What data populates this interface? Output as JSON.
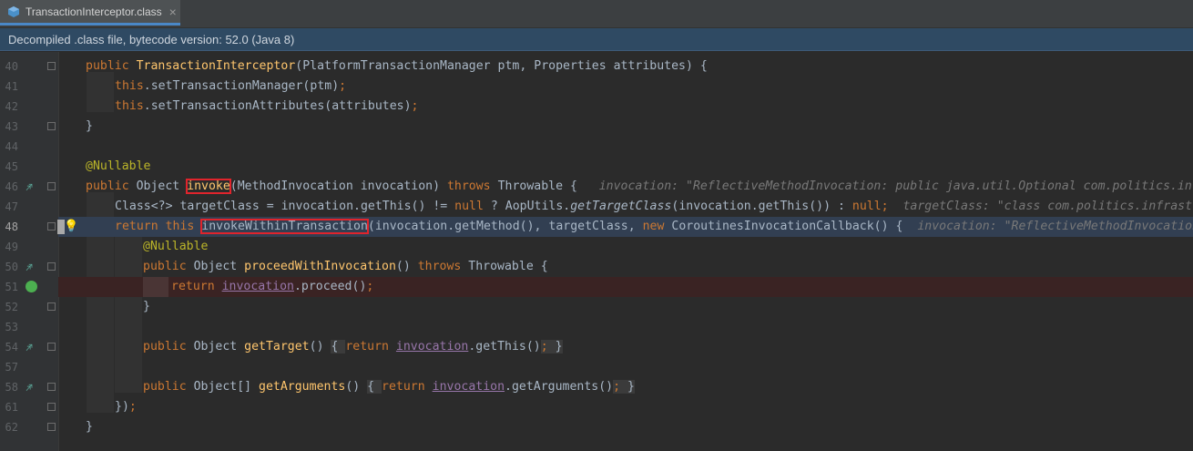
{
  "tab": {
    "label": "TransactionInterceptor.class",
    "close": "×"
  },
  "banner": {
    "text": "Decompiled .class file, bytecode version: 52.0 (Java 8)"
  },
  "lines": [
    {
      "n": "40"
    },
    {
      "n": "41"
    },
    {
      "n": "42"
    },
    {
      "n": "43"
    },
    {
      "n": "44"
    },
    {
      "n": "45"
    },
    {
      "n": "46"
    },
    {
      "n": "47"
    },
    {
      "n": "48"
    },
    {
      "n": "49"
    },
    {
      "n": "50"
    },
    {
      "n": "51"
    },
    {
      "n": "52"
    },
    {
      "n": "53"
    },
    {
      "n": "54"
    },
    {
      "n": "57"
    },
    {
      "n": "58"
    },
    {
      "n": "61"
    },
    {
      "n": "62"
    }
  ],
  "code": {
    "l40": {
      "kw": "public ",
      "fn": "TransactionInterceptor",
      "rest": "(PlatformTransactionManager ptm, Properties attributes) {"
    },
    "l41": {
      "kw": "this",
      "rest": ".setTransactionManager(ptm)",
      "semi": ";"
    },
    "l42": {
      "kw": "this",
      "rest": ".setTransactionAttributes(attributes)",
      "semi": ";"
    },
    "l43": {
      "rest": "}"
    },
    "l45": {
      "ann": "@Nullable"
    },
    "l46": {
      "kw": "public ",
      "t1": "Object ",
      "fn": "invoke",
      "t2": "(MethodInvocation invocation) ",
      "kw2": "throws ",
      "t3": "Throwable {",
      "hint": "invocation: \"ReflectiveMethodInvocation: public java.util.Optional com.politics.infrastr"
    },
    "l47": {
      "t1": "Class<?> targetClass = invocation.getThis() != ",
      "kw": "null",
      "t2": " ? AopUtils.",
      "it": "getTargetClass",
      "t3": "(invocation.getThis()) : ",
      "kw2": "null",
      "semi": ";",
      "hint": "targetClass: \"class com.politics.infrastruc"
    },
    "l48": {
      "kw": "return this ",
      "fn": "invokeWithinTransaction",
      "t1": "(invocation.getMethod(), targetClass, ",
      "kw2": "new ",
      "t2": "CoroutinesInvocationCallback() {",
      "hint": "invocation: \"ReflectiveMethodInvocation: "
    },
    "l49": {
      "ann": "@Nullable"
    },
    "l50": {
      "kw": "public ",
      "t1": "Object ",
      "fn": "proceedWithInvocation",
      "t2": "() ",
      "kw2": "throws ",
      "t3": "Throwable {"
    },
    "l51": {
      "kw": "return ",
      "field": "invocation",
      "t1": ".proceed()",
      "semi": ";"
    },
    "l52": {
      "rest": "}"
    },
    "l54": {
      "kw": "public ",
      "t1": "Object ",
      "fn": "getTarget",
      "t2": "() ",
      "b1": "{ ",
      "kw2": "return ",
      "field": "invocation",
      "t3": ".getThis()",
      "semi": "; ",
      "b2": "}"
    },
    "l58": {
      "kw": "public ",
      "t1": "Object[] ",
      "fn": "getArguments",
      "t2": "() ",
      "b1": "{ ",
      "kw2": "return ",
      "field": "invocation",
      "t3": ".getArguments()",
      "semi": "; ",
      "b2": "}"
    },
    "l61": {
      "t1": "})",
      "semi": ";"
    },
    "l62": {
      "rest": "}"
    }
  },
  "colors": {
    "keyword": "#cc7832",
    "annotation": "#bbb529",
    "method": "#ffc66d",
    "field": "#9876aa",
    "text": "#a9b7c6",
    "highlight_box": "#e0242c"
  }
}
